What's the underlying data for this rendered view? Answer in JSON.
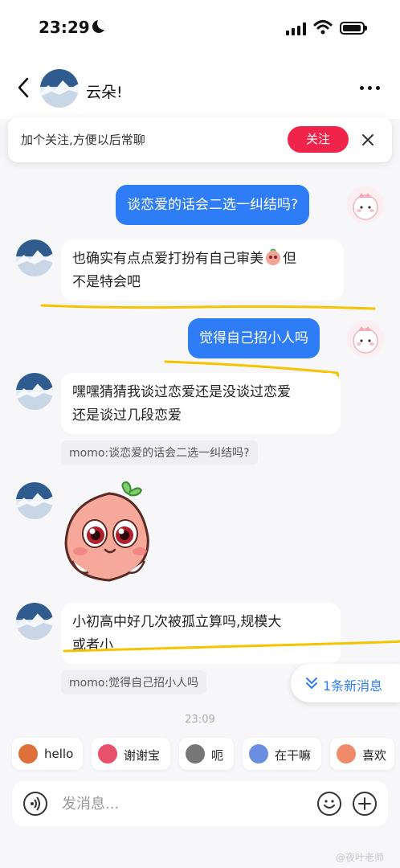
{
  "status_bar": {
    "time": "23:29"
  },
  "header": {
    "name": "云朵!"
  },
  "follow_banner": {
    "text": "加个关注,方便以后常聊",
    "button": "关注"
  },
  "messages": {
    "m1": {
      "text": "谈恋爱的话会二选一纠结吗?"
    },
    "m2": {
      "line1": "也确实有点点爱打扮有自己审美",
      "line2": "不是特会吧",
      "emoji_after": "但"
    },
    "m3": {
      "text": "觉得自己招小人吗"
    },
    "m4": {
      "line1": "嘿嘿猜猜我谈过恋爱还是没谈过恋爱",
      "line2": "还是谈过几段恋爱",
      "quote": "momo:谈恋爱的话会二选一纠结吗?"
    },
    "m6": {
      "line1": "小初高中好几次被孤立算吗,规模大",
      "line2": "或者小",
      "quote": "momo:觉得自己招小人吗"
    }
  },
  "new_messages": {
    "label": "1条新消息"
  },
  "timestamp": "23:09",
  "quick_replies": [
    {
      "label": "hello",
      "color": "#e0703a"
    },
    {
      "label": "谢谢宝",
      "color": "#e9506a"
    },
    {
      "label": "呃",
      "color": "#777777"
    },
    {
      "label": "在干嘛",
      "color": "#6a8fe0"
    },
    {
      "label": "喜欢",
      "color": "#f08a6a"
    }
  ],
  "input": {
    "placeholder": "发消息..."
  },
  "watermark": "@夜叶老师",
  "colors": {
    "accent_blue": "#2f7df6",
    "follow_red": "#f0244a",
    "highlight_yellow": "#f5c400"
  }
}
